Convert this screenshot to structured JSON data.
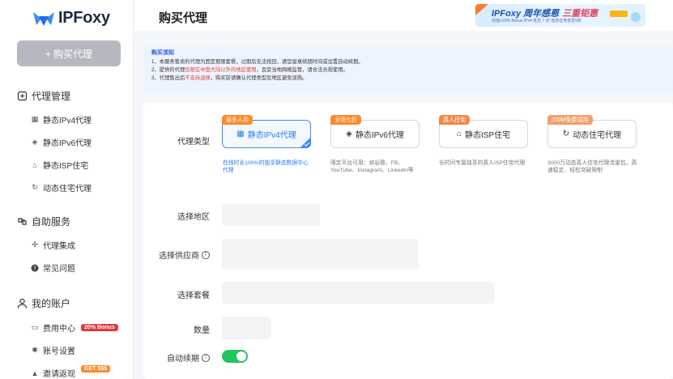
{
  "brand": {
    "name": "IPFoxy",
    "accent": "#3c8cff"
  },
  "sidebar": {
    "buy_button": "+ 购买代理",
    "groups": [
      {
        "title": "代理管理",
        "items": [
          "静态IPv4代理",
          "静态IPv6代理",
          "静态ISP住宅",
          "动态住宅代理"
        ]
      },
      {
        "title": "自助服务",
        "items": [
          "代理集成",
          "常见问题"
        ]
      },
      {
        "title": "我的账户",
        "items": [
          "费用中心",
          "账号设置",
          "邀请返现"
        ]
      }
    ],
    "badges": {
      "bonus": "20% Bonus",
      "get": "GET $$$"
    }
  },
  "header": {
    "title": "购买代理",
    "promo": {
      "line1a": "IPFoxy 周年感恩",
      "line1b": "三重钜惠",
      "line2": "充值+20% Bonus   IPv4 低至 7 折   动态住宅低至6折"
    }
  },
  "notice": {
    "title": "购买须知",
    "line1": "1、本服务售卖的代理为固定期限套餐，过期后无法找回，请您留意续期时间或设置自动续期。",
    "line2_pre": "2、提供的代理",
    "line2_hl": "仅限在中国大陆以外的地区使用",
    "line2_post": "，且受当地网络监管，请合法合规使用。",
    "line3_pre": "3、代理售出后",
    "line3_hl": "不支持退换",
    "line3_post": "，购买前请确认代理类型及地区避免误购。"
  },
  "form": {
    "labels": {
      "proxy_type": "代理类型",
      "region": "选择地区",
      "provider": "选择供应商",
      "package": "选择套餐",
      "quantity": "数量",
      "auto_renew": "自动续期"
    },
    "auto_renew_on": true,
    "types": [
      {
        "tag": "最多人用",
        "tag_color": "#ff8a2a",
        "label": "静态IPv4代理",
        "desc": "在线时长100%的独享静态数据中心代理",
        "active": true
      },
      {
        "tag": "全场七折",
        "tag_color": "#ff8a2a",
        "label": "静态IPv6代理",
        "desc": "限定平台可用：如谷歌、FB、YouTube、Instagram、Linkedin等",
        "active": false
      },
      {
        "tag": "真人住宅",
        "tag_color": "#f08a4b",
        "label": "静态ISP住宅",
        "desc": "长时间专属独享的真人ISP住宅代理",
        "active": false
      },
      {
        "tag": "200M免费试用",
        "tag_color": "#f2a06a",
        "label": "动态住宅代理",
        "desc": "3000万动态真人住宅代理流量包，高速稳定，轻松突破限制",
        "active": false
      }
    ]
  }
}
